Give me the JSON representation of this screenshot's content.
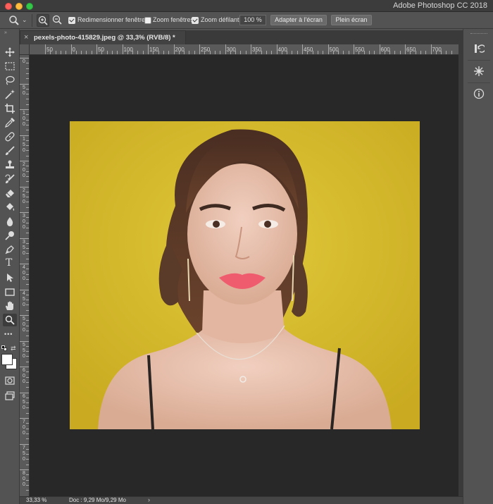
{
  "window": {
    "title": "Adobe Photoshop CC 2018"
  },
  "options_bar": {
    "active_tool_icon": "zoom-icon",
    "zoom_in_icon": "zoom-in-icon",
    "zoom_out_icon": "zoom-out-icon",
    "resize_windows": {
      "label": "Redimensionner fenêtres",
      "checked": true
    },
    "zoom_all_windows": {
      "label": "Zoom fenêtres",
      "checked": false
    },
    "scrubby_zoom": {
      "label": "Zoom défilant",
      "checked": true
    },
    "zoom_value": "100 %",
    "fit_screen_label": "Adapter à l'écran",
    "fill_screen_label": "Plein écran"
  },
  "document": {
    "tab_close": "×",
    "tab_title": "pexels-photo-415829.jpeg @ 33,3% (RVB/8) *"
  },
  "rulers": {
    "horizontal": [
      "50",
      "0",
      "50",
      "100",
      "150",
      "200",
      "250",
      "300",
      "350",
      "400",
      "450",
      "500",
      "550",
      "600",
      "650",
      "700"
    ],
    "vertical": [
      [
        "0"
      ],
      [
        "5",
        "0"
      ],
      [
        "1",
        "0",
        "0"
      ],
      [
        "1",
        "5",
        "0"
      ],
      [
        "2",
        "0",
        "0"
      ],
      [
        "2",
        "5",
        "0"
      ],
      [
        "3",
        "0",
        "0"
      ],
      [
        "3",
        "5",
        "0"
      ],
      [
        "4",
        "0",
        "0"
      ],
      [
        "4",
        "5",
        "0"
      ],
      [
        "5",
        "0",
        "0"
      ],
      [
        "5",
        "5",
        "0"
      ],
      [
        "6",
        "0",
        "0"
      ],
      [
        "6",
        "5",
        "0"
      ],
      [
        "7",
        "0",
        "0"
      ],
      [
        "7",
        "5",
        "0"
      ],
      [
        "8",
        "0",
        "0"
      ]
    ]
  },
  "tools": [
    "move-icon",
    "marquee-icon",
    "lasso-icon",
    "magic-wand-icon",
    "crop-icon",
    "eyedropper-icon",
    "healing-brush-icon",
    "brush-icon",
    "clone-stamp-icon",
    "history-brush-icon",
    "eraser-icon",
    "paint-bucket-icon",
    "blur-icon",
    "dodge-icon",
    "pen-icon",
    "type-icon",
    "path-selection-icon",
    "rectangle-icon",
    "hand-icon",
    "zoom-icon",
    "more-tools-icon"
  ],
  "type_tool_glyph": "T",
  "more_tools_glyph": "•••",
  "colors": {
    "foreground": "#ffffff",
    "background": "#ffffff",
    "canvas_bg": "#282828",
    "photo_bg": "#d8bd2c"
  },
  "status": {
    "zoom": "33,33 %",
    "doc": "Doc : 9,29 Mo/9,29 Mo",
    "arrow": "›"
  },
  "right_panel": {
    "icons": [
      "history-icon",
      "adjustments-icon",
      "info-icon"
    ]
  }
}
